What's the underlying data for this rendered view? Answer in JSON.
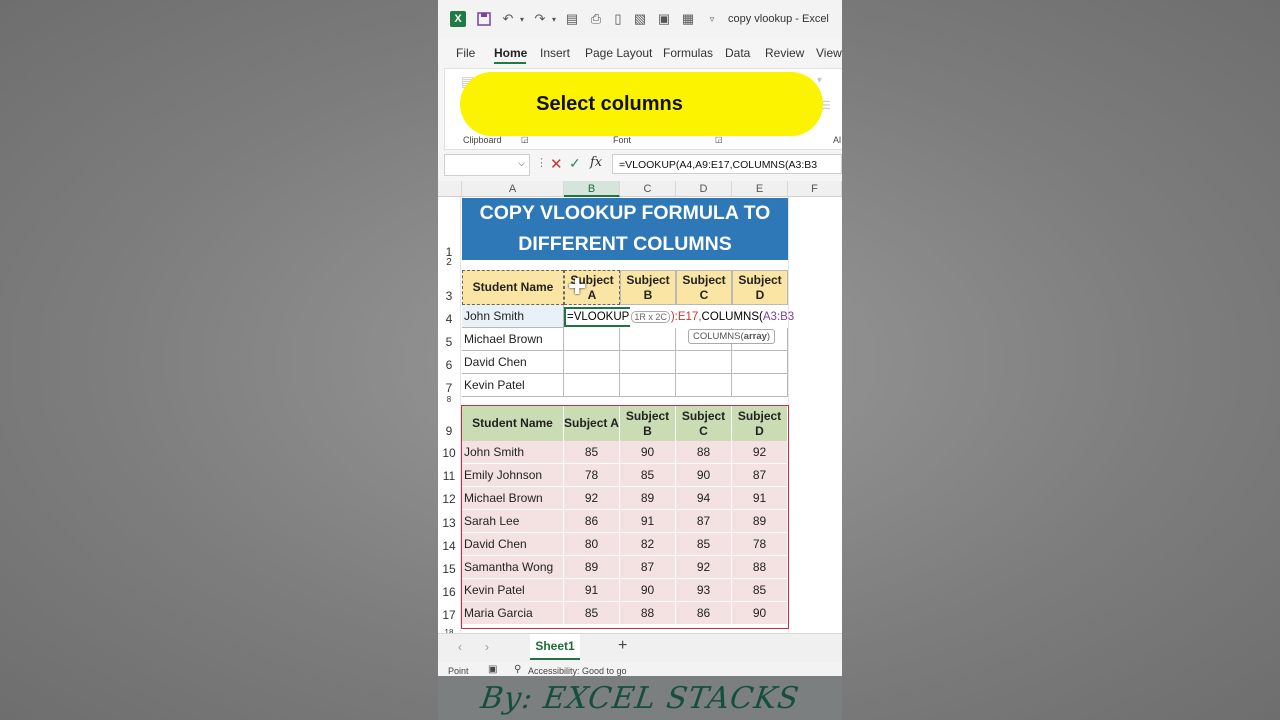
{
  "window": {
    "title": "copy vlookup - Excel"
  },
  "menu": [
    "File",
    "Home",
    "Insert",
    "Page Layout",
    "Formulas",
    "Data",
    "Review",
    "View"
  ],
  "ribbon": {
    "groups": [
      "Clipboard",
      "Font",
      "Al"
    ],
    "banner": "Select columns"
  },
  "formula_bar": {
    "formula": "=VLOOKUP(A4,A9:E17,COLUMNS(A3:B3"
  },
  "columns": [
    "A",
    "B",
    "C",
    "D",
    "E",
    "F"
  ],
  "rows": [
    "1",
    "2",
    "3",
    "4",
    "5",
    "6",
    "7",
    "8",
    "9",
    "10",
    "11",
    "12",
    "13",
    "14",
    "15",
    "16",
    "17",
    "18"
  ],
  "sheet_title": [
    "COPY VLOOKUP FORMULA TO",
    "DIFFERENT COLUMNS"
  ],
  "table1": {
    "headers": [
      "Student Name",
      "Subject A",
      "Subject B",
      "Subject C",
      "Subject D"
    ],
    "names": [
      "John Smith",
      "Michael Brown",
      "David Chen",
      "Kevin Patel"
    ],
    "editing": {
      "part1": "=VLOOKUP",
      "range_tip": "1R x 2C",
      "part2": "):E17,",
      "part3": "COLUMNS(",
      "part4": "A3:B3",
      "tooltip_fn": "COLUMNS(",
      "tooltip_arg": "array",
      "tooltip_end": ")"
    }
  },
  "table2": {
    "headers": [
      "Student Name",
      "Subject A",
      "Subject B",
      "Subject C",
      "Subject D"
    ],
    "rows": [
      [
        "John Smith",
        "85",
        "90",
        "88",
        "92"
      ],
      [
        "Emily Johnson",
        "78",
        "85",
        "90",
        "87"
      ],
      [
        "Michael Brown",
        "92",
        "89",
        "94",
        "91"
      ],
      [
        "Sarah Lee",
        "86",
        "91",
        "87",
        "89"
      ],
      [
        "David Chen",
        "80",
        "82",
        "85",
        "78"
      ],
      [
        "Samantha Wong",
        "89",
        "87",
        "92",
        "88"
      ],
      [
        "Kevin Patel",
        "91",
        "90",
        "93",
        "85"
      ],
      [
        "Maria Garcia",
        "85",
        "88",
        "86",
        "90"
      ]
    ]
  },
  "sheets": {
    "active": "Sheet1",
    "add": "+"
  },
  "status": {
    "mode": "Point",
    "accessibility": "Accessibility: Good to go"
  },
  "footer": {
    "credit": "By: EXCEL STACKS"
  },
  "colors": {
    "excel_green": "#217346",
    "title_blue": "#2e78b7",
    "banner_yellow": "#fbf300",
    "header_yellow": "#fbe5a4",
    "header_green": "#c9dcb4",
    "row_pink": "#f4e2e2"
  }
}
